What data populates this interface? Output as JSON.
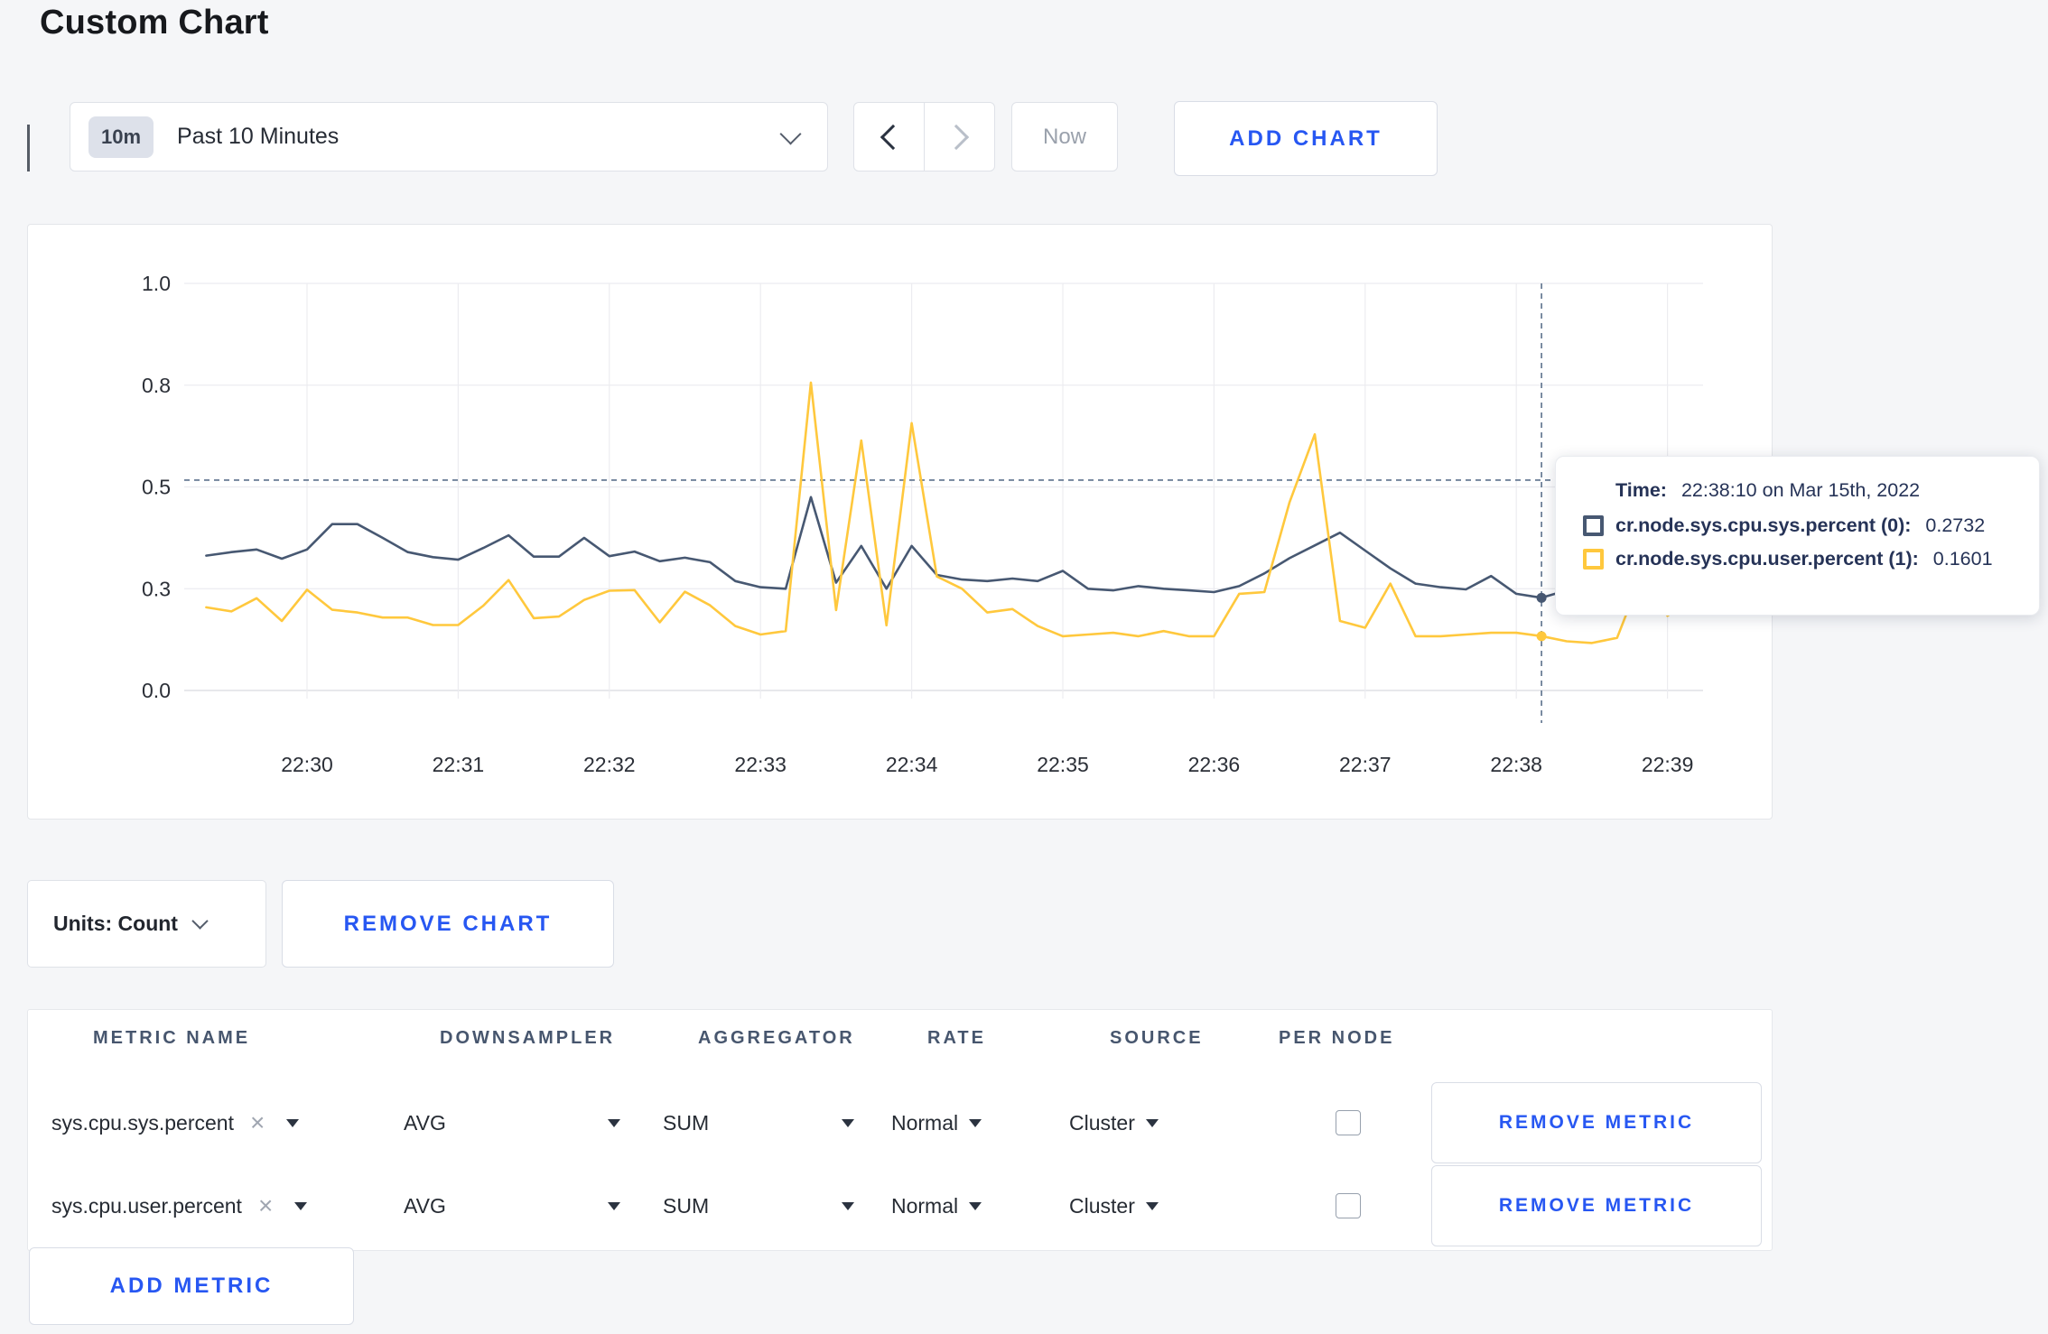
{
  "page": {
    "title": "Custom Chart",
    "accent_color": "#2757f2",
    "background": "#f5f6f8"
  },
  "toolbar": {
    "time_window_badge": "10m",
    "time_window_label": "Past 10 Minutes",
    "now_label": "Now",
    "add_chart_label": "ADD CHART"
  },
  "chart_controls": {
    "units_label": "Units: Count",
    "remove_chart_label": "REMOVE CHART",
    "add_metric_label": "ADD METRIC"
  },
  "tooltip": {
    "time_label": "Time:",
    "time_value": "22:38:10 on Mar 15th, 2022",
    "rows": [
      {
        "label": "cr.node.sys.cpu.sys.percent (0):",
        "value": "0.2732",
        "color": "#475872"
      },
      {
        "label": "cr.node.sys.cpu.user.percent (1):",
        "value": "0.1601",
        "color": "#ffc83d"
      }
    ]
  },
  "metrics_table": {
    "headers": [
      "METRIC NAME",
      "DOWNSAMPLER",
      "AGGREGATOR",
      "RATE",
      "SOURCE",
      "PER NODE"
    ],
    "rows": [
      {
        "metric": "sys.cpu.sys.percent",
        "downsampler": "AVG",
        "aggregator": "SUM",
        "rate": "Normal",
        "source": "Cluster",
        "per_node": false,
        "remove_label": "REMOVE METRIC"
      },
      {
        "metric": "sys.cpu.user.percent",
        "downsampler": "AVG",
        "aggregator": "SUM",
        "rate": "Normal",
        "source": "Cluster",
        "per_node": false,
        "remove_label": "REMOVE METRIC"
      }
    ]
  },
  "icons": {
    "clear": "×"
  },
  "chart_data": {
    "type": "line",
    "title": "",
    "xlabel": "",
    "ylabel": "",
    "grid": true,
    "legend_position": "tooltip-only",
    "y_ticks": [
      "0.0",
      "0.3",
      "0.5",
      "0.8",
      "1.0"
    ],
    "y_tick_values": [
      0,
      0.3,
      0.5,
      0.8,
      1.0
    ],
    "ylim": [
      0,
      1.0
    ],
    "x_tick_labels": [
      "22:30",
      "22:31",
      "22:32",
      "22:33",
      "22:34",
      "22:35",
      "22:36",
      "22:37",
      "22:38",
      "22:39"
    ],
    "t_start_min": -0.6667,
    "t_step_min": 0.16667,
    "series": [
      {
        "name": "cr.node.sys.cpu.sys.percent (0)",
        "color": "#475872",
        "values": [
          0.365,
          0.372,
          0.377,
          0.359,
          0.377,
          0.427,
          0.427,
          0.4,
          0.372,
          0.362,
          0.357,
          0.38,
          0.405,
          0.363,
          0.363,
          0.4,
          0.364,
          0.373,
          0.354,
          0.361,
          0.352,
          0.315,
          0.303,
          0.3,
          0.48,
          0.312,
          0.384,
          0.3,
          0.384,
          0.327,
          0.318,
          0.315,
          0.32,
          0.315,
          0.335,
          0.3,
          0.295,
          0.305,
          0.3,
          0.295,
          0.29,
          0.305,
          0.33,
          0.36,
          0.385,
          0.41,
          0.375,
          0.34,
          0.31,
          0.303,
          0.298,
          0.325,
          0.285,
          0.2732,
          0.295,
          0.31,
          0.3,
          0.3,
          0.3,
          0.3
        ]
      },
      {
        "name": "cr.node.sys.cpu.user.percent (1)",
        "color": "#ffc83d",
        "values": [
          0.245,
          0.233,
          0.272,
          0.205,
          0.297,
          0.238,
          0.23,
          0.215,
          0.215,
          0.193,
          0.193,
          0.25,
          0.317,
          0.213,
          0.218,
          0.267,
          0.294,
          0.296,
          0.201,
          0.291,
          0.251,
          0.19,
          0.165,
          0.175,
          0.805,
          0.237,
          0.637,
          0.192,
          0.688,
          0.324,
          0.3,
          0.23,
          0.24,
          0.19,
          0.16,
          0.165,
          0.17,
          0.16,
          0.175,
          0.16,
          0.16,
          0.285,
          0.29,
          0.47,
          0.655,
          0.205,
          0.185,
          0.31,
          0.16,
          0.16,
          0.165,
          0.17,
          0.17,
          0.1601,
          0.145,
          0.14,
          0.155,
          0.33,
          0.22,
          0.275
        ]
      }
    ],
    "crosshair": {
      "time_min": 8.1667,
      "hline_value": 0.52,
      "dot_values": [
        0.2732,
        0.1601
      ]
    }
  }
}
